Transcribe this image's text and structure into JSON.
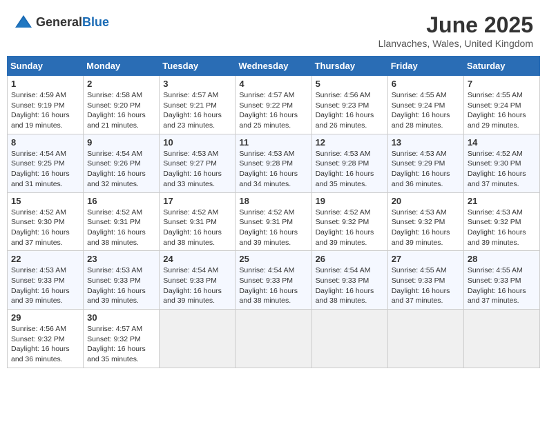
{
  "header": {
    "logo_general": "General",
    "logo_blue": "Blue",
    "title": "June 2025",
    "subtitle": "Llanvaches, Wales, United Kingdom"
  },
  "columns": [
    "Sunday",
    "Monday",
    "Tuesday",
    "Wednesday",
    "Thursday",
    "Friday",
    "Saturday"
  ],
  "weeks": [
    [
      {
        "day": "1",
        "sunrise": "4:59 AM",
        "sunset": "9:19 PM",
        "daylight": "16 hours and 19 minutes."
      },
      {
        "day": "2",
        "sunrise": "4:58 AM",
        "sunset": "9:20 PM",
        "daylight": "16 hours and 21 minutes."
      },
      {
        "day": "3",
        "sunrise": "4:57 AM",
        "sunset": "9:21 PM",
        "daylight": "16 hours and 23 minutes."
      },
      {
        "day": "4",
        "sunrise": "4:57 AM",
        "sunset": "9:22 PM",
        "daylight": "16 hours and 25 minutes."
      },
      {
        "day": "5",
        "sunrise": "4:56 AM",
        "sunset": "9:23 PM",
        "daylight": "16 hours and 26 minutes."
      },
      {
        "day": "6",
        "sunrise": "4:55 AM",
        "sunset": "9:24 PM",
        "daylight": "16 hours and 28 minutes."
      },
      {
        "day": "7",
        "sunrise": "4:55 AM",
        "sunset": "9:24 PM",
        "daylight": "16 hours and 29 minutes."
      }
    ],
    [
      {
        "day": "8",
        "sunrise": "4:54 AM",
        "sunset": "9:25 PM",
        "daylight": "16 hours and 31 minutes."
      },
      {
        "day": "9",
        "sunrise": "4:54 AM",
        "sunset": "9:26 PM",
        "daylight": "16 hours and 32 minutes."
      },
      {
        "day": "10",
        "sunrise": "4:53 AM",
        "sunset": "9:27 PM",
        "daylight": "16 hours and 33 minutes."
      },
      {
        "day": "11",
        "sunrise": "4:53 AM",
        "sunset": "9:28 PM",
        "daylight": "16 hours and 34 minutes."
      },
      {
        "day": "12",
        "sunrise": "4:53 AM",
        "sunset": "9:28 PM",
        "daylight": "16 hours and 35 minutes."
      },
      {
        "day": "13",
        "sunrise": "4:53 AM",
        "sunset": "9:29 PM",
        "daylight": "16 hours and 36 minutes."
      },
      {
        "day": "14",
        "sunrise": "4:52 AM",
        "sunset": "9:30 PM",
        "daylight": "16 hours and 37 minutes."
      }
    ],
    [
      {
        "day": "15",
        "sunrise": "4:52 AM",
        "sunset": "9:30 PM",
        "daylight": "16 hours and 37 minutes."
      },
      {
        "day": "16",
        "sunrise": "4:52 AM",
        "sunset": "9:31 PM",
        "daylight": "16 hours and 38 minutes."
      },
      {
        "day": "17",
        "sunrise": "4:52 AM",
        "sunset": "9:31 PM",
        "daylight": "16 hours and 38 minutes."
      },
      {
        "day": "18",
        "sunrise": "4:52 AM",
        "sunset": "9:31 PM",
        "daylight": "16 hours and 39 minutes."
      },
      {
        "day": "19",
        "sunrise": "4:52 AM",
        "sunset": "9:32 PM",
        "daylight": "16 hours and 39 minutes."
      },
      {
        "day": "20",
        "sunrise": "4:53 AM",
        "sunset": "9:32 PM",
        "daylight": "16 hours and 39 minutes."
      },
      {
        "day": "21",
        "sunrise": "4:53 AM",
        "sunset": "9:32 PM",
        "daylight": "16 hours and 39 minutes."
      }
    ],
    [
      {
        "day": "22",
        "sunrise": "4:53 AM",
        "sunset": "9:33 PM",
        "daylight": "16 hours and 39 minutes."
      },
      {
        "day": "23",
        "sunrise": "4:53 AM",
        "sunset": "9:33 PM",
        "daylight": "16 hours and 39 minutes."
      },
      {
        "day": "24",
        "sunrise": "4:54 AM",
        "sunset": "9:33 PM",
        "daylight": "16 hours and 39 minutes."
      },
      {
        "day": "25",
        "sunrise": "4:54 AM",
        "sunset": "9:33 PM",
        "daylight": "16 hours and 38 minutes."
      },
      {
        "day": "26",
        "sunrise": "4:54 AM",
        "sunset": "9:33 PM",
        "daylight": "16 hours and 38 minutes."
      },
      {
        "day": "27",
        "sunrise": "4:55 AM",
        "sunset": "9:33 PM",
        "daylight": "16 hours and 37 minutes."
      },
      {
        "day": "28",
        "sunrise": "4:55 AM",
        "sunset": "9:33 PM",
        "daylight": "16 hours and 37 minutes."
      }
    ],
    [
      {
        "day": "29",
        "sunrise": "4:56 AM",
        "sunset": "9:32 PM",
        "daylight": "16 hours and 36 minutes."
      },
      {
        "day": "30",
        "sunrise": "4:57 AM",
        "sunset": "9:32 PM",
        "daylight": "16 hours and 35 minutes."
      },
      null,
      null,
      null,
      null,
      null
    ]
  ]
}
